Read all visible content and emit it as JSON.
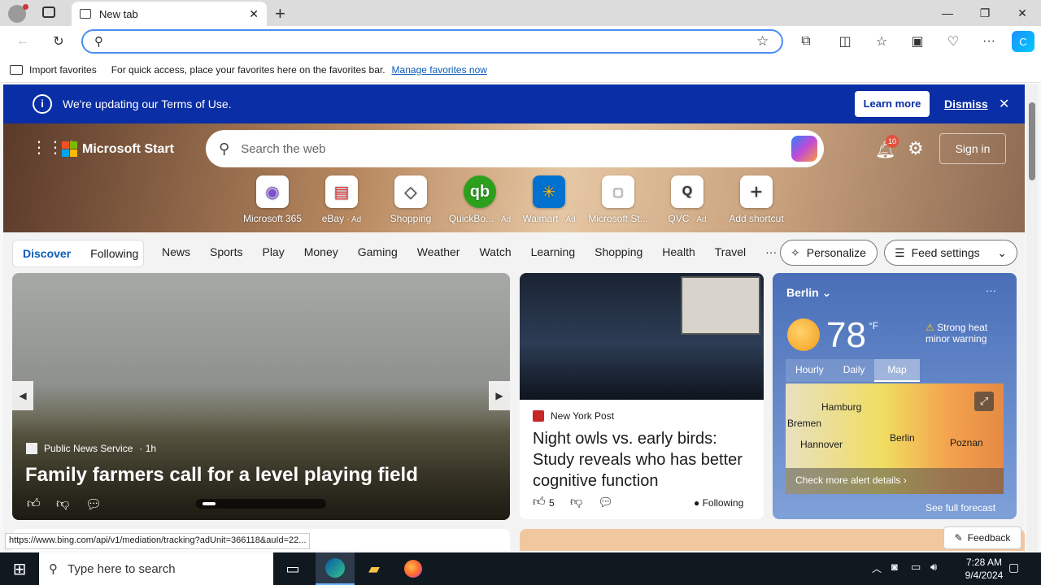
{
  "browser": {
    "tab_title": "New tab",
    "favbar": {
      "import_label": "Import favorites",
      "hint": "For quick access, place your favorites here on the favorites bar.",
      "manage_link": "Manage favorites now"
    }
  },
  "banner": {
    "text": "We're updating our Terms of Use.",
    "learn_more": "Learn more",
    "dismiss": "Dismiss"
  },
  "msstart": {
    "brand": "Microsoft Start",
    "search_placeholder": "Search the web",
    "notification_count": "10",
    "sign_in": "Sign in",
    "shortcuts": [
      {
        "label": "Microsoft 365",
        "ad": ""
      },
      {
        "label": "eBay",
        "ad": "· Ad"
      },
      {
        "label": "Shopping",
        "ad": ""
      },
      {
        "label": "QuickBo...",
        "ad": "· Ad"
      },
      {
        "label": "Walmart",
        "ad": "· Ad"
      },
      {
        "label": "Microsoft St...",
        "ad": ""
      },
      {
        "label": "QVC",
        "ad": "· Ad"
      },
      {
        "label": "Add shortcut",
        "ad": ""
      }
    ]
  },
  "nav": {
    "discover": "Discover",
    "following": "Following",
    "items": [
      "News",
      "Sports",
      "Play",
      "Money",
      "Gaming",
      "Weather",
      "Watch",
      "Learning",
      "Shopping",
      "Health",
      "Travel"
    ],
    "more": "···",
    "personalize": "Personalize",
    "feed_settings": "Feed settings"
  },
  "hero_story": {
    "source": "Public News Service",
    "age": "· 1h",
    "headline": "Family farmers call for a level playing field"
  },
  "story2": {
    "source": "New York Post",
    "headline": "Night owls vs. early birds: Study reveals who has better cognitive function",
    "likes": "5",
    "following": "Following"
  },
  "weather": {
    "city": "Berlin",
    "temp": "78",
    "unit": "°F",
    "alert": "Strong heat minor warning",
    "tabs": [
      "Hourly",
      "Daily",
      "Map"
    ],
    "active_tab": "Map",
    "map_labels": [
      "Hamburg",
      "Bremen",
      "Hannover",
      "Berlin",
      "Poznan"
    ],
    "alert_link": "Check more alert details",
    "forecast_link": "See full forecast"
  },
  "status_url": "https://www.bing.com/api/v1/mediation/tracking?adUnit=366118&auId=22...",
  "feedback": "Feedback",
  "taskbar": {
    "search_placeholder": "Type here to search",
    "time": "7:28 AM",
    "date": "9/4/2024"
  },
  "colors": {
    "banner": "#0a2ea5",
    "accent": "#0b5cb8"
  }
}
